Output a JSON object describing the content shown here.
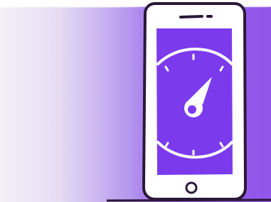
{
  "colors": {
    "background_light": "#f3eef8",
    "background_accent": "#9156ea",
    "screen": "#7c3aed",
    "outline": "#2a1838",
    "device_body": "#ffffff",
    "dial_marks": "#ffffff"
  },
  "illustration": {
    "device": "smartphone",
    "screen_content": "speedometer-gauge",
    "icons": [
      "smartphone-icon",
      "speaker-slot-icon",
      "gauge-icon",
      "gauge-needle-icon",
      "home-button-icon"
    ]
  }
}
